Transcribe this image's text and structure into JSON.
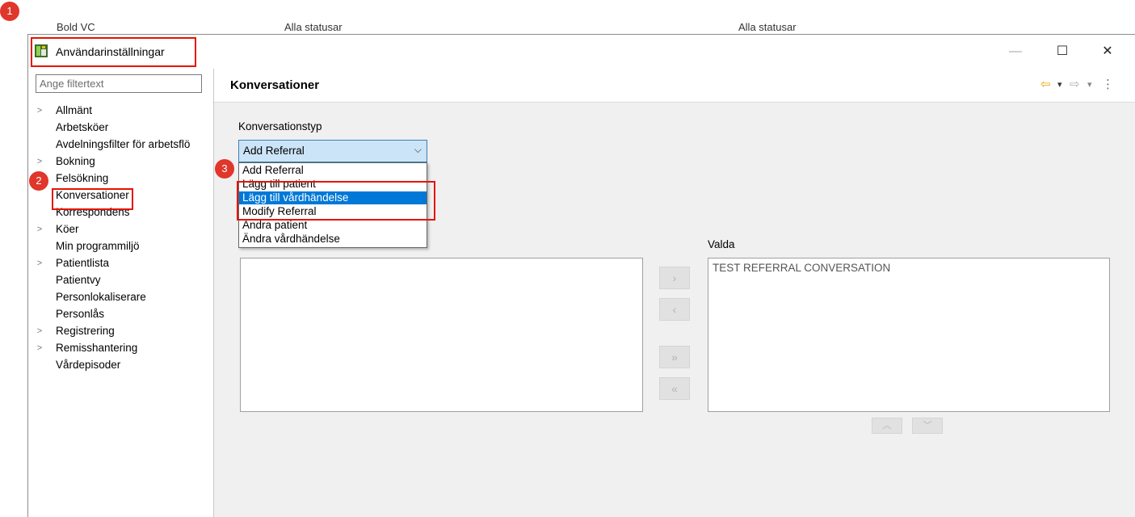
{
  "background_window": {
    "texts": [
      "Bold VC",
      "Alla statusar",
      "Alla statusar"
    ]
  },
  "window": {
    "title": "Användarinställningar",
    "minimize": "—",
    "maximize": "☐",
    "close": "✕"
  },
  "filter": {
    "placeholder": "Ange filtertext",
    "value": ""
  },
  "tree": {
    "items": [
      {
        "label": "Allmänt",
        "expandable": true
      },
      {
        "label": "Arbetsköer",
        "expandable": false
      },
      {
        "label": "Avdelningsfilter för arbetsflö",
        "expandable": false
      },
      {
        "label": "Bokning",
        "expandable": true
      },
      {
        "label": "Felsökning",
        "expandable": false
      },
      {
        "label": "Konversationer",
        "expandable": false,
        "selected": true
      },
      {
        "label": "Korrespondens",
        "expandable": false
      },
      {
        "label": "Köer",
        "expandable": true
      },
      {
        "label": "Min programmiljö",
        "expandable": false
      },
      {
        "label": "Patientlista",
        "expandable": true
      },
      {
        "label": "Patientvy",
        "expandable": false
      },
      {
        "label": "Personlokaliserare",
        "expandable": false
      },
      {
        "label": "Personlås",
        "expandable": false
      },
      {
        "label": "Registrering",
        "expandable": true
      },
      {
        "label": "Remisshantering",
        "expandable": true
      },
      {
        "label": "Vårdepisoder",
        "expandable": false
      }
    ]
  },
  "page": {
    "title": "Konversationer",
    "nav": {
      "back": "⇦",
      "back_menu": "▾",
      "forward": "⇨",
      "forward_menu": "▾",
      "more": "⋮"
    }
  },
  "conversation_type": {
    "label": "Konversationstyp",
    "selected": "Add Referral",
    "chevron": "⌵",
    "options": [
      {
        "label": "Add Referral",
        "highlighted": false
      },
      {
        "label": "Lägg till patient",
        "highlighted": false
      },
      {
        "label": "Lägg till vårdhändelse",
        "highlighted": true
      },
      {
        "label": "Modify Referral",
        "highlighted": false
      },
      {
        "label": "Ändra patient",
        "highlighted": false
      },
      {
        "label": "Ändra vårdhändelse",
        "highlighted": false
      }
    ]
  },
  "selected_list": {
    "label": "Valda",
    "items": [
      "TEST REFERRAL CONVERSATION"
    ]
  },
  "move_buttons": {
    "add": "›",
    "remove": "‹",
    "add_all": "»",
    "remove_all": "«"
  },
  "order_buttons": {
    "up": "︿",
    "down": "﹀"
  },
  "badges": [
    "1",
    "2",
    "3"
  ],
  "colors": {
    "selection": "#0078d7",
    "annotation": "#e51400",
    "badge": "#e0362b",
    "combo_bg": "#cce4f7",
    "nav_back": "#e8a800"
  }
}
